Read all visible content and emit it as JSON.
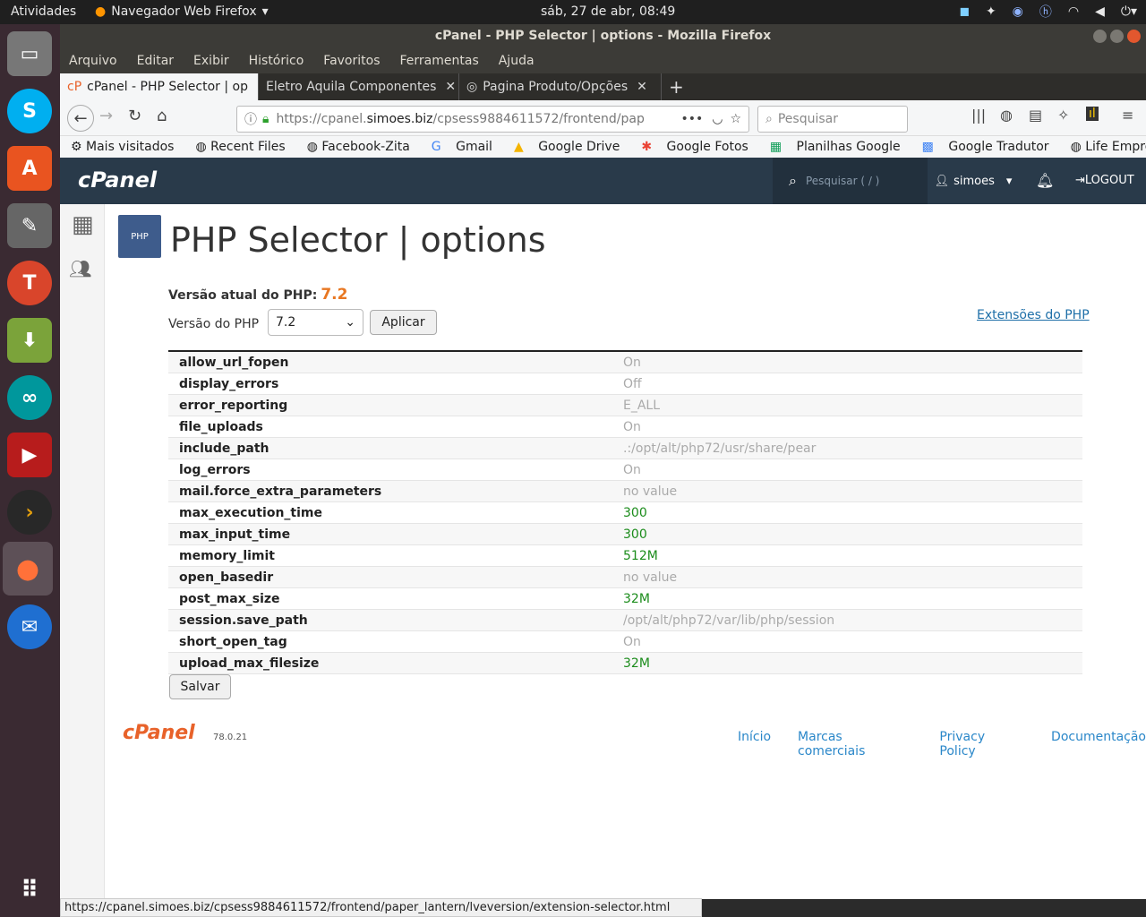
{
  "topbar": {
    "activities": "Atividades",
    "app_name": "Navegador Web Firefox",
    "clock": "sáb, 27 de abr, 08:49"
  },
  "window": {
    "title": "cPanel - PHP Selector | options - Mozilla Firefox"
  },
  "menu": [
    "Arquivo",
    "Editar",
    "Exibir",
    "Histórico",
    "Favoritos",
    "Ferramentas",
    "Ajuda"
  ],
  "tabs": [
    {
      "label": "cPanel - PHP Selector | op"
    },
    {
      "label": "Eletro Aquila Componentes"
    },
    {
      "label": "Pagina Produto/Opções"
    }
  ],
  "urlbar": {
    "prefix": "https://cpanel.",
    "domain": "simoes.biz",
    "path": "/cpsess9884611572/frontend/pap"
  },
  "search": {
    "placeholder": "Pesquisar"
  },
  "bookmarks": [
    "Mais visitados",
    "Recent Files",
    "Facebook-Zita",
    "Gmail",
    "Google Drive",
    "Google Fotos",
    "Planilhas Google",
    "Google Tradutor",
    "Life Empresarial - 000..."
  ],
  "cpanel": {
    "logo": "cPanel",
    "search_placeholder": "Pesquisar ( / )",
    "user": "simoes",
    "logout": "LOGOUT"
  },
  "page": {
    "title": "PHP Selector | options",
    "current_version_label": "Versão atual do PHP:",
    "current_version": "7.2",
    "version_label": "Versão do PHP",
    "selected_version": "7.2",
    "apply": "Aplicar",
    "extensions_link": "Extensões do PHP",
    "save": "Salvar"
  },
  "options": [
    {
      "name": "allow_url_fopen",
      "value": "On",
      "status": "default"
    },
    {
      "name": "display_errors",
      "value": "Off",
      "status": "default"
    },
    {
      "name": "error_reporting",
      "value": "E_ALL",
      "status": "default"
    },
    {
      "name": "file_uploads",
      "value": "On",
      "status": "default"
    },
    {
      "name": "include_path",
      "value": ".:/opt/alt/php72/usr/share/pear",
      "status": "default"
    },
    {
      "name": "log_errors",
      "value": "On",
      "status": "default"
    },
    {
      "name": "mail.force_extra_parameters",
      "value": "no value",
      "status": "default"
    },
    {
      "name": "max_execution_time",
      "value": "300",
      "status": "custom"
    },
    {
      "name": "max_input_time",
      "value": "300",
      "status": "custom"
    },
    {
      "name": "memory_limit",
      "value": "512M",
      "status": "custom"
    },
    {
      "name": "open_basedir",
      "value": "no value",
      "status": "default"
    },
    {
      "name": "post_max_size",
      "value": "32M",
      "status": "custom"
    },
    {
      "name": "session.save_path",
      "value": "/opt/alt/php72/var/lib/php/session",
      "status": "default"
    },
    {
      "name": "short_open_tag",
      "value": "On",
      "status": "default"
    },
    {
      "name": "upload_max_filesize",
      "value": "32M",
      "status": "custom"
    }
  ],
  "footer": {
    "logo": "cPanel",
    "version": "78.0.21",
    "links": [
      "Início",
      "Marcas comerciais",
      "Privacy Policy",
      "Documentação"
    ]
  },
  "status_url": "https://cpanel.simoes.biz/cpsess9884611572/frontend/paper_lantern/lveversion/extension-selector.html",
  "colors": {
    "accent_orange": "#e87722",
    "custom_value_green": "#1b8c1b",
    "cpanel_header": "#293a4a",
    "link_blue": "#2a87c9"
  }
}
